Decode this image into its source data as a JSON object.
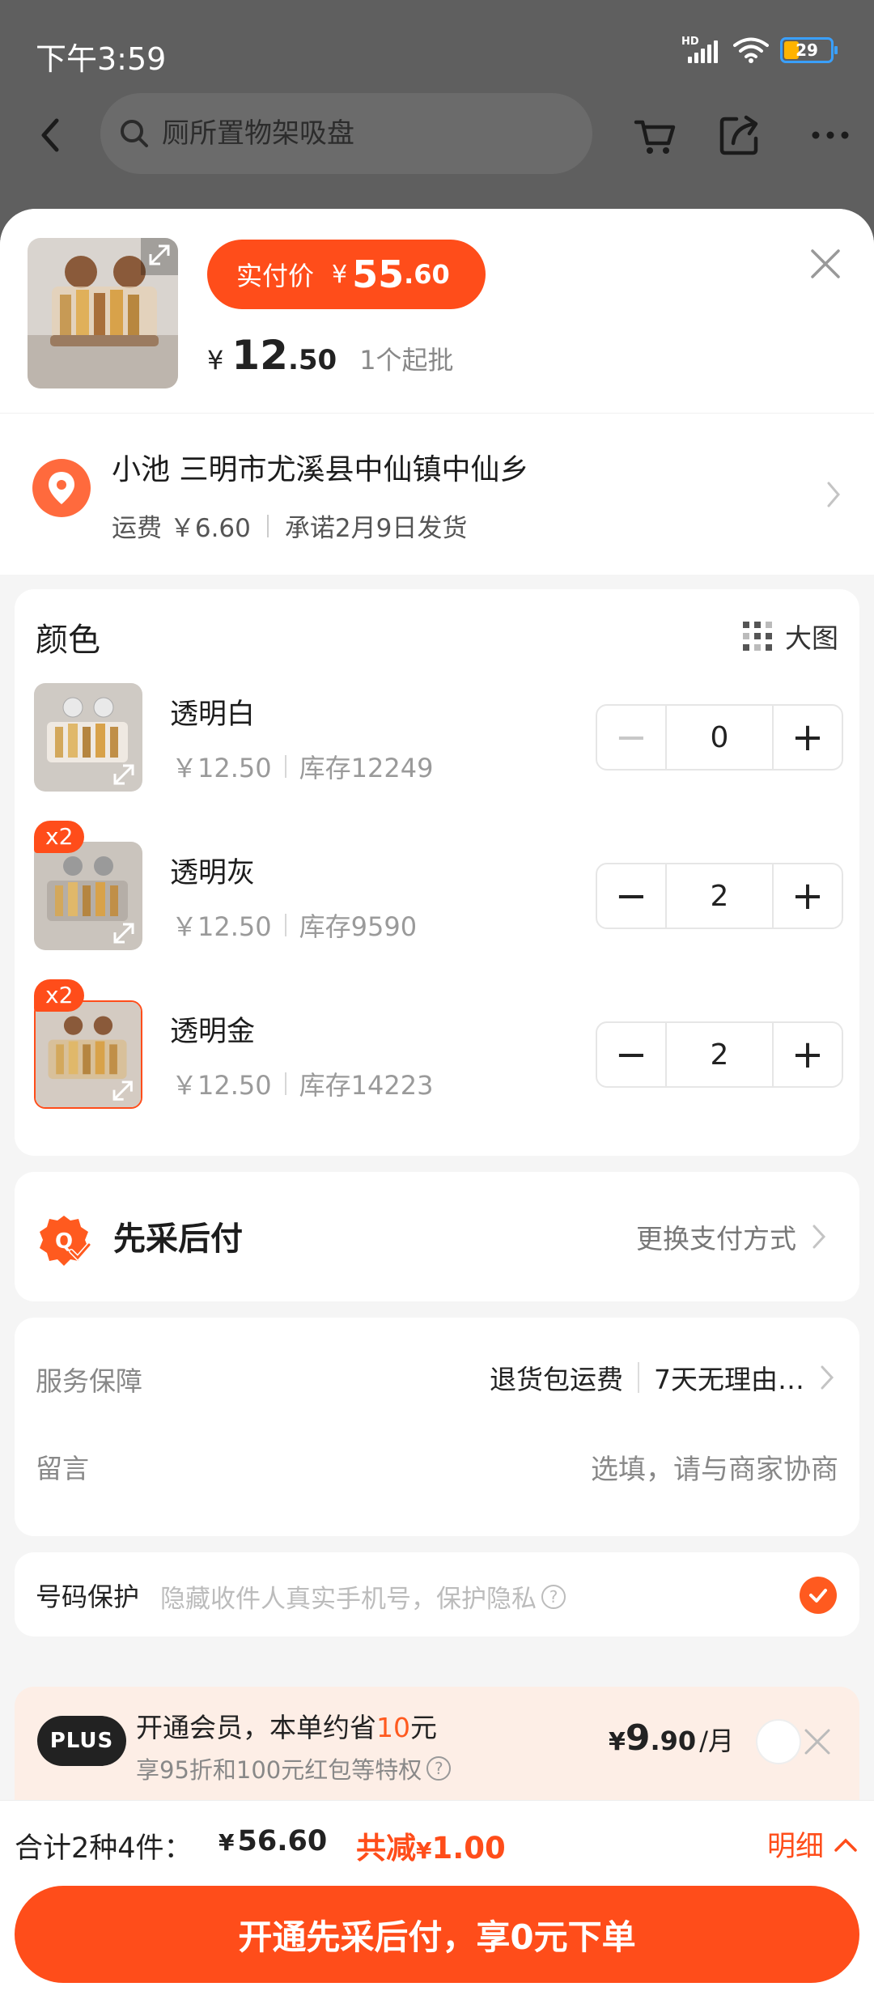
{
  "status_bar": {
    "time": "下午3:59",
    "battery": "29"
  },
  "nav": {
    "search_placeholder": "厕所置物架吸盘"
  },
  "product": {
    "price_label": "实付价",
    "currency": "¥",
    "price_int": "55",
    "price_dec": ".60",
    "unit_price_int": "12",
    "unit_price_dec": ".50",
    "min_order": "1个起批"
  },
  "address": {
    "line": "小池 三明市尤溪县中仙镇中仙乡",
    "shipping_fee": "运费 ￥6.60",
    "ship_promise": "承诺2月9日发货"
  },
  "colors": {
    "title": "颜色",
    "big_image_label": "大图",
    "variants": [
      {
        "name": "透明白",
        "price": "￥12.50",
        "stock": "库存12249",
        "qty": "0",
        "badge": ""
      },
      {
        "name": "透明灰",
        "price": "￥12.50",
        "stock": "库存9590",
        "qty": "2",
        "badge": "x2"
      },
      {
        "name": "透明金",
        "price": "￥12.50",
        "stock": "库存14223",
        "qty": "2",
        "badge": "x2"
      }
    ]
  },
  "payment": {
    "title": "先采后付",
    "change_label": "更换支付方式"
  },
  "service": {
    "label": "服务保障",
    "value1": "退货包运费",
    "value2": "7天无理由…",
    "message_label": "留言",
    "message_hint": "选填，请与商家协商"
  },
  "privacy": {
    "label": "号码保护",
    "hint": "隐藏收件人真实手机号，保护隐私"
  },
  "plus": {
    "logo": "PLUS",
    "title_pre": "开通会员，本单约省",
    "title_amount": "10",
    "title_post": "元",
    "subtitle": "享95折和100元红包等特权",
    "price_cur": "¥",
    "price_int": "9",
    "price_dec": ".90",
    "price_per": "/月"
  },
  "summary": {
    "label": "合计2种4件：",
    "amount": "56.60",
    "discount_label": "共减",
    "discount_amount": "1.00",
    "detail_label": "明细"
  },
  "cta": {
    "label": "开通先采后付，享0元下单"
  },
  "colors_theme": {
    "accent": "#ff4d1a",
    "plus_bg": "#fdeee6"
  }
}
